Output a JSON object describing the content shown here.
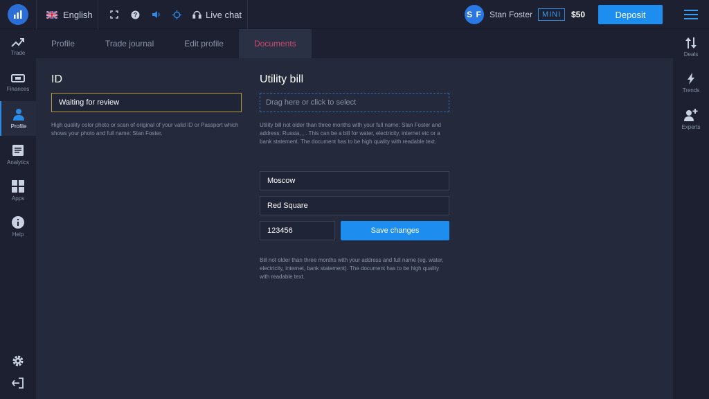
{
  "header": {
    "language": "English",
    "live_chat": "Live chat",
    "user_initials": "S F",
    "user_name": "Stan Foster",
    "account_badge": "MINI",
    "balance": "$50",
    "deposit_label": "Deposit"
  },
  "left_nav": [
    {
      "label": "Trade",
      "icon": "chart-up-icon"
    },
    {
      "label": "Finances",
      "icon": "cash-icon"
    },
    {
      "label": "Profile",
      "icon": "user-icon",
      "active": true
    },
    {
      "label": "Analytics",
      "icon": "document-icon"
    },
    {
      "label": "Apps",
      "icon": "grid-icon"
    },
    {
      "label": "Help",
      "icon": "info-icon"
    }
  ],
  "right_nav": [
    {
      "label": "Deals",
      "icon": "arrows-updown-icon"
    },
    {
      "label": "Trends",
      "icon": "lightning-icon"
    },
    {
      "label": "Experts",
      "icon": "add-user-icon"
    }
  ],
  "tabs": [
    "Profile",
    "Trade journal",
    "Edit profile",
    "Documents"
  ],
  "active_tab": "Documents",
  "id_section": {
    "title": "ID",
    "status": "Waiting for review",
    "note": "High quality color photo or scan of original of your valid ID or Passport which shows your photo and full name: Stan Foster."
  },
  "utility_section": {
    "title": "Utility bill",
    "dropzone": "Drag here or click to select",
    "note": "Utility bill not older than three months with your full name: Stan Foster and address: Russia, , . This can be a bill for water, electricity, internet etc or a bank statement. The document has to be high quality with readable text.",
    "city": "Moscow",
    "street": "Red Square",
    "postal": "123456",
    "save_label": "Save changes",
    "footer_note": "Bill not older than three months with your address and full name (eg. water, electricity, internet, bank statement). The document has to be high quality with readable text."
  },
  "colors": {
    "accent": "#1d8ef0",
    "active_tab": "#d0476a",
    "review_border": "#b99a3c",
    "background": "#242a3c"
  }
}
